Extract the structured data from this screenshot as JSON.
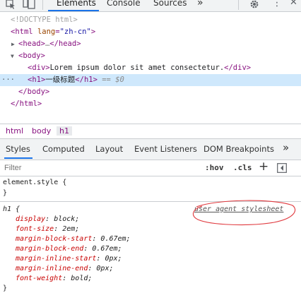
{
  "toolbar": {
    "tabs": [
      "Elements",
      "Console",
      "Sources"
    ],
    "more": "»",
    "menu": "⋮",
    "close": "✕"
  },
  "dom": {
    "doctype": "<!DOCTYPE html>",
    "html_tag": "html",
    "lang_attr": "lang",
    "lang_val": "\"zh-cn\"",
    "head_open": "<head>",
    "head_ellipsis": "…",
    "head_close": "</head>",
    "body_open": "<body>",
    "div_open": "<div>",
    "div_text": "Lorem ipsum dolor sit amet consectetur.",
    "div_close": "</div>",
    "h1_open": "<h1>",
    "h1_text": "一级标题",
    "h1_close": "</h1>",
    "selected_marker": "== $0",
    "body_close": "</body>",
    "html_close": "</html>",
    "gutter": "···"
  },
  "breadcrumb": [
    "html",
    "body",
    "h1"
  ],
  "panel_tabs": [
    "Styles",
    "Computed",
    "Layout",
    "Event Listeners",
    "DOM Breakpoints"
  ],
  "panel_more": "»",
  "filter": {
    "placeholder": "Filter",
    "hov": ":hov",
    "cls": ".cls",
    "plus": "+"
  },
  "rules": {
    "element_style_selector": "element.style {",
    "element_style_close": "}",
    "h1_selector": "h1 {",
    "h1_source": "user agent stylesheet",
    "h1_close": "}",
    "h1_declarations": [
      {
        "prop": "display",
        "value": "block;"
      },
      {
        "prop": "font-size",
        "value": "2em;"
      },
      {
        "prop": "margin-block-start",
        "value": "0.67em;"
      },
      {
        "prop": "margin-block-end",
        "value": "0.67em;"
      },
      {
        "prop": "margin-inline-start",
        "value": "0px;"
      },
      {
        "prop": "margin-inline-end",
        "value": "0px;"
      },
      {
        "prop": "font-weight",
        "value": "bold;"
      }
    ]
  },
  "colors": {
    "accent": "#1a73e8",
    "tag": "#881280",
    "property": "#c80000",
    "annotation_circle": "#e0393e",
    "selected_row": "#cfe8fc"
  }
}
